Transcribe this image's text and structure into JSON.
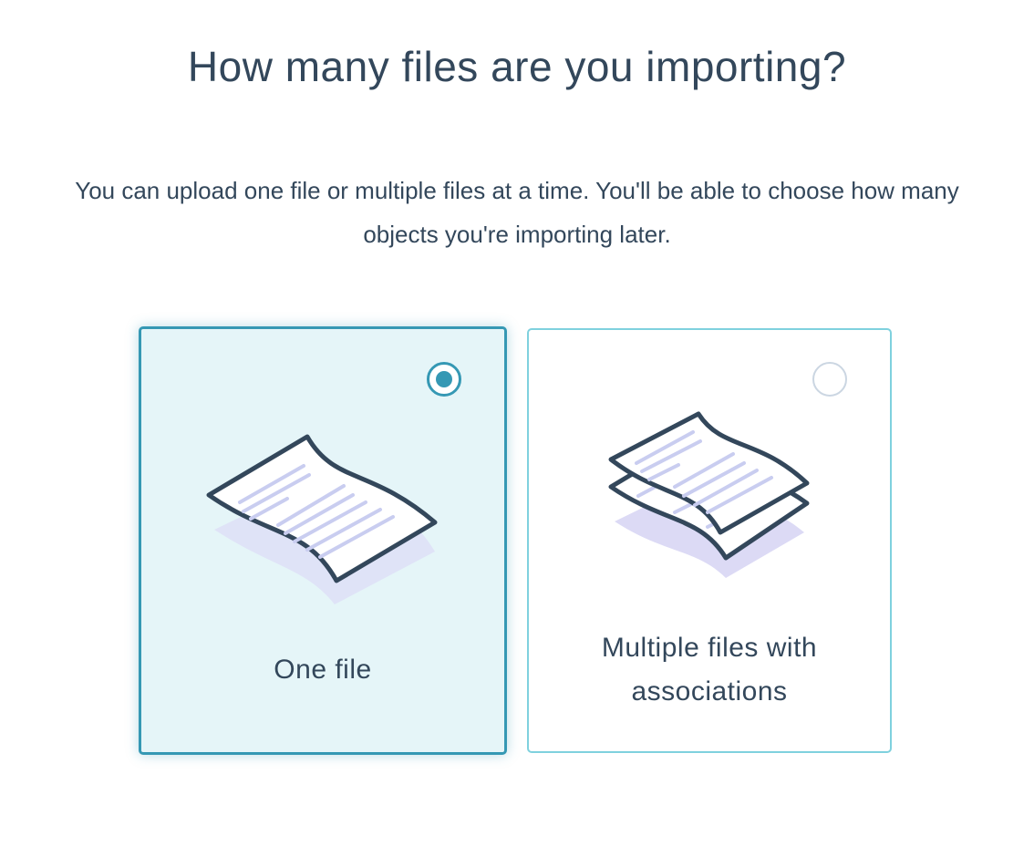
{
  "header": {
    "title": "How many files are you importing?",
    "subtitle": "You can upload one file or multiple files at a time. You'll be able to choose how many objects you're importing later."
  },
  "options": [
    {
      "label": "One file",
      "selected": true,
      "icon": "single-document-icon"
    },
    {
      "label": "Multiple files with associations",
      "selected": false,
      "icon": "stacked-documents-icon"
    }
  ],
  "colors": {
    "text": "#33475b",
    "accent": "#3598b4",
    "selected_background": "#e5f5f8",
    "card_border": "#7fd1de",
    "radio_border": "#cbd6e2",
    "shadow": "#dfe3f7"
  }
}
